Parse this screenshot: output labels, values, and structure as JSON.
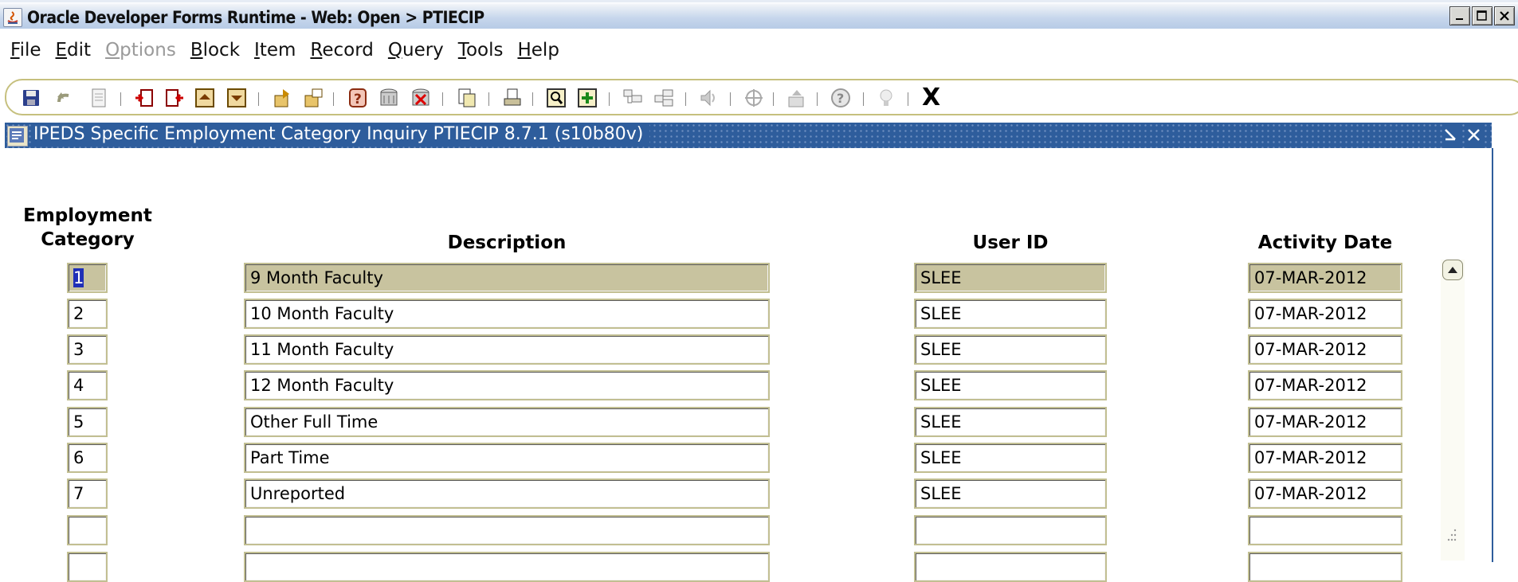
{
  "window": {
    "title": "Oracle Developer Forms Runtime - Web:  Open > PTIECIP"
  },
  "menu": [
    {
      "key": "file",
      "mnemonic": "F",
      "rest": "ile",
      "enabled": true
    },
    {
      "key": "edit",
      "mnemonic": "E",
      "rest": "dit",
      "enabled": true
    },
    {
      "key": "options",
      "mnemonic": "O",
      "rest": "ptions",
      "enabled": false
    },
    {
      "key": "block",
      "mnemonic": "B",
      "rest": "lock",
      "enabled": true
    },
    {
      "key": "item",
      "mnemonic": "I",
      "rest": "tem",
      "enabled": true
    },
    {
      "key": "record",
      "mnemonic": "R",
      "rest": "ecord",
      "enabled": true
    },
    {
      "key": "query",
      "mnemonic": "Q",
      "rest": "uery",
      "enabled": true
    },
    {
      "key": "tools",
      "mnemonic": "T",
      "rest": "ools",
      "enabled": true
    },
    {
      "key": "help",
      "mnemonic": "H",
      "rest": "elp",
      "enabled": true
    }
  ],
  "toolbar": {
    "exit_label": "X",
    "icons": [
      "save-icon",
      "rollback-icon",
      "print-doc-icon",
      "insert-record-icon",
      "remove-record-icon",
      "previous-block-icon",
      "next-block-icon",
      "enter-query-icon",
      "execute-query-icon",
      "cancel-query-icon",
      "count-query-icon",
      "query-table-icon",
      "clear-record-icon",
      "print-icon",
      "search-icon",
      "insert-icon",
      "duplicate-item-icon",
      "duplicate-record-icon",
      "sound-icon",
      "target-icon",
      "export-icon",
      "help-icon",
      "lightbulb-icon"
    ]
  },
  "form": {
    "title": "IPEDS Specific Employment Category Inquiry  PTIECIP  8.7.1  (s10b80v)",
    "headers": {
      "category_line1": "Employment",
      "category_line2": "Category",
      "description": "Description",
      "user_id": "User ID",
      "activity_date": "Activity Date"
    },
    "rows": [
      {
        "category": "1",
        "description": "9 Month Faculty",
        "user_id": "SLEE",
        "activity_date": "07-MAR-2012"
      },
      {
        "category": "2",
        "description": "10 Month Faculty",
        "user_id": "SLEE",
        "activity_date": "07-MAR-2012"
      },
      {
        "category": "3",
        "description": "11 Month Faculty",
        "user_id": "SLEE",
        "activity_date": "07-MAR-2012"
      },
      {
        "category": "4",
        "description": "12 Month Faculty",
        "user_id": "SLEE",
        "activity_date": "07-MAR-2012"
      },
      {
        "category": "5",
        "description": "Other Full Time",
        "user_id": "SLEE",
        "activity_date": "07-MAR-2012"
      },
      {
        "category": "6",
        "description": "Part Time",
        "user_id": "SLEE",
        "activity_date": "07-MAR-2012"
      },
      {
        "category": "7",
        "description": "Unreported",
        "user_id": "SLEE",
        "activity_date": "07-MAR-2012"
      },
      {
        "category": "",
        "description": "",
        "user_id": "",
        "activity_date": ""
      },
      {
        "category": "",
        "description": "",
        "user_id": "",
        "activity_date": ""
      }
    ]
  },
  "colors": {
    "current_row": "#c8c39f",
    "title_blue": "#2e5d9c",
    "selection": "#1f2fb7"
  }
}
